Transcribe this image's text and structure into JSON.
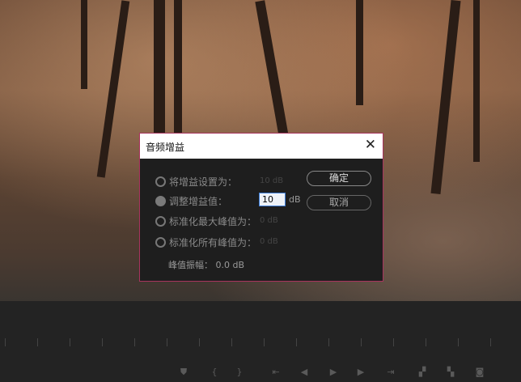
{
  "dialog": {
    "title": "音频增益",
    "options": [
      {
        "label": "将增益设置为：",
        "value": "10 dB",
        "selected": false
      },
      {
        "label": "调整增益值：",
        "value": "10",
        "unit": "dB",
        "selected": true
      },
      {
        "label": "标准化最大峰值为：",
        "value": "0 dB",
        "selected": false
      },
      {
        "label": "标准化所有峰值为：",
        "value": "0 dB",
        "selected": false
      }
    ],
    "ok_label": "确定",
    "cancel_label": "取消",
    "peak_label": "峰值振幅：",
    "peak_value": "0.0 dB"
  },
  "controls": [
    "marker-icon",
    "mark-in-icon",
    "mark-out-icon",
    "go-to-in-icon",
    "step-back-icon",
    "play-icon",
    "step-forward-icon",
    "go-to-out-icon",
    "insert-icon",
    "overwrite-icon",
    "export-frame-icon"
  ]
}
